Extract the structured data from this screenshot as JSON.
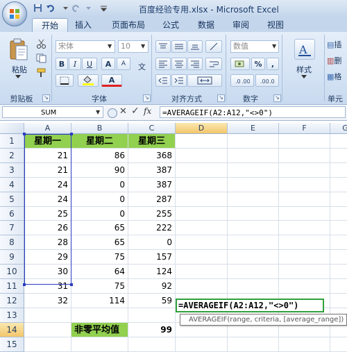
{
  "window": {
    "title": "百度经验专用.xlsx - Microsoft Excel"
  },
  "tabs": [
    "开始",
    "插入",
    "页面布局",
    "公式",
    "数据",
    "审阅",
    "视图"
  ],
  "ribbon": {
    "clipboard": {
      "paste_label": "粘贴",
      "group_label": "剪贴板"
    },
    "font": {
      "font_name": "宋体",
      "font_size": "10",
      "bold": "B",
      "italic": "I",
      "underline": "U",
      "grow": "A",
      "shrink": "A",
      "color_a": "A",
      "group_label": "字体"
    },
    "alignment": {
      "group_label": "对齐方式"
    },
    "number": {
      "format": "数值",
      "percent": "%",
      "comma": ",",
      "group_label": "数字"
    },
    "styles": {
      "label": "样式"
    },
    "cells": {
      "insert_label": "插",
      "delete_label": "删",
      "format_label": "格",
      "group_label": "单元"
    }
  },
  "formula_bar": {
    "name_box": "SUM",
    "cancel": "✕",
    "enter": "✓",
    "fx": "fx",
    "formula": "=AVERAGEIF(A2:A12,\"<>0\")"
  },
  "sheet": {
    "columns": [
      "A",
      "B",
      "C",
      "D",
      "E",
      "F",
      "G"
    ],
    "rows": [
      "1",
      "2",
      "3",
      "4",
      "5",
      "6",
      "7",
      "8",
      "9",
      "10",
      "11",
      "12",
      "13",
      "14",
      "15"
    ],
    "headers": [
      "星期一",
      "星期二",
      "星期三"
    ],
    "data": [
      [
        "21",
        "86",
        "368"
      ],
      [
        "21",
        "90",
        "387"
      ],
      [
        "24",
        "0",
        "387"
      ],
      [
        "24",
        "0",
        "287"
      ],
      [
        "25",
        "0",
        "255"
      ],
      [
        "26",
        "65",
        "222"
      ],
      [
        "28",
        "65",
        "0"
      ],
      [
        "29",
        "75",
        "157"
      ],
      [
        "30",
        "64",
        "124"
      ],
      [
        "31",
        "75",
        "92"
      ],
      [
        "32",
        "114",
        "59"
      ]
    ],
    "summary_label": "非零平均值",
    "summary_value": "99",
    "editing_formula": "=AVERAGEIF(A2:A12,\"<>0\")",
    "tooltip": "AVERAGEIF(range, criteria, [average_range])"
  },
  "colors": {
    "header_fill": "#92d050",
    "selection_border": "#2a3cbf",
    "edit_border": "#2ea03a"
  }
}
